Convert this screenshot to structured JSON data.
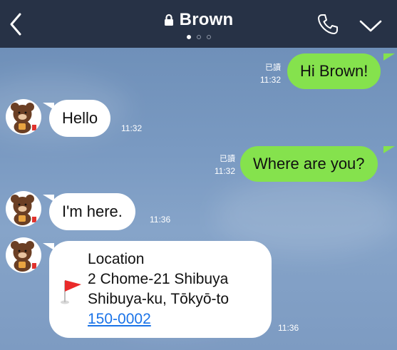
{
  "header": {
    "title": "Brown",
    "page_dots": 3,
    "active_dot": 0,
    "icons": {
      "back": "chevron-left-icon",
      "lock": "lock-icon",
      "call": "phone-icon",
      "menu": "chevron-down-icon"
    }
  },
  "colors": {
    "header_bg": "#273246",
    "outgoing_bubble": "#85e24d",
    "incoming_bubble": "#ffffff",
    "chat_bg": "#7a9ac2",
    "link": "#1a73e8"
  },
  "messages": [
    {
      "direction": "outgoing",
      "text": "Hi Brown!",
      "read_label": "已讀",
      "time": "11:32"
    },
    {
      "direction": "incoming",
      "text": "Hello",
      "time": "11:32"
    },
    {
      "direction": "outgoing",
      "text": "Where are you?",
      "read_label": "已讀",
      "time": "11:32"
    },
    {
      "direction": "incoming",
      "text": "I'm here.",
      "time": "11:36"
    },
    {
      "direction": "incoming",
      "type": "location",
      "title": "Location",
      "address_line1": "2 Chome-21 Shibuya",
      "address_line2": "Shibuya-ku, Tōkyō-to",
      "postal_code": "150-0002",
      "time": "11:36",
      "icon": "flag-icon"
    }
  ]
}
